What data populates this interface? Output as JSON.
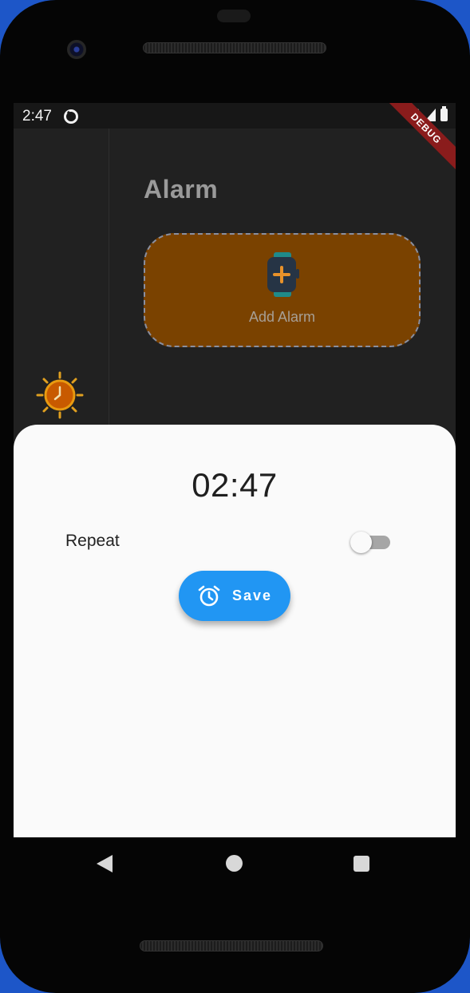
{
  "status_bar": {
    "time": "2:47",
    "icons": [
      "app-notification-icon",
      "wifi-icon",
      "signal-icon",
      "battery-icon"
    ],
    "debug_banner": "DEBUG"
  },
  "sidebar": {
    "icon": "clock-sun-icon"
  },
  "main": {
    "title": "Alarm",
    "add_alarm": {
      "label": "Add Alarm",
      "icon": "add-alarm-icon",
      "color": "#7a4200"
    }
  },
  "sheet": {
    "time": "02:47",
    "repeat_label": "Repeat",
    "repeat_on": false,
    "save_label": "Save",
    "save_icon": "alarm-clock-icon",
    "save_color": "#2196f3"
  },
  "nav": {
    "buttons": [
      "back",
      "home",
      "recents"
    ]
  }
}
